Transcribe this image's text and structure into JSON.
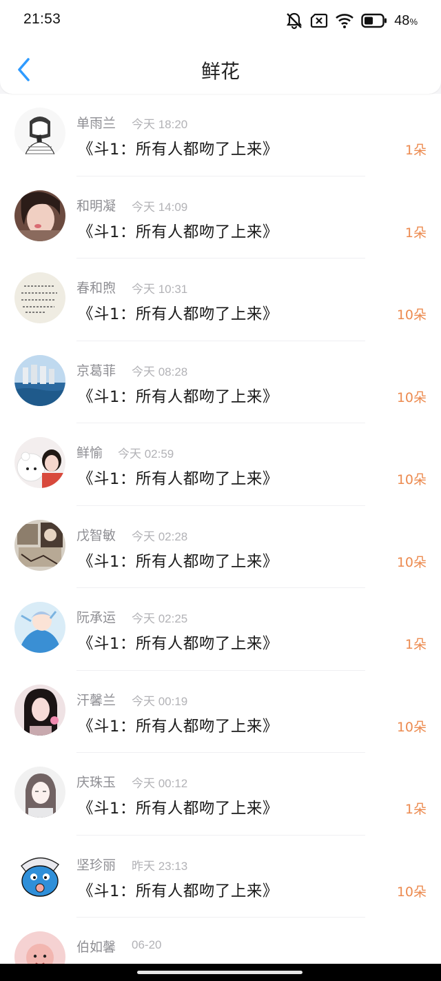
{
  "status_bar": {
    "time": "21:53",
    "battery_percent": "48",
    "battery_unit": "%",
    "battery_level": 0.48,
    "icons": [
      "mute-bell-icon",
      "sim-off-icon",
      "wifi-icon",
      "battery-icon"
    ]
  },
  "header": {
    "title": "鲜花",
    "back_icon": "chevron-left-icon",
    "accent_color": "#2f9bff"
  },
  "colors": {
    "amount": "#ec8a4f",
    "name": "#8e8e93",
    "timestamp": "#b2b2b6"
  },
  "items": [
    {
      "name": "单雨兰",
      "time": "今天 18:20",
      "book": "《斗1：所有人都吻了上来》",
      "amount": "1朵",
      "avatar": "sketch-girl-braid"
    },
    {
      "name": "和明凝",
      "time": "今天 14:09",
      "book": "《斗1：所有人都吻了上来》",
      "amount": "1朵",
      "avatar": "girl-selfie"
    },
    {
      "name": "春和煦",
      "time": "今天 10:31",
      "book": "《斗1：所有人都吻了上来》",
      "amount": "10朵",
      "avatar": "handwriting-paper"
    },
    {
      "name": "京葛菲",
      "time": "今天 08:28",
      "book": "《斗1：所有人都吻了上来》",
      "amount": "10朵",
      "avatar": "seaside-towers"
    },
    {
      "name": "鲜愉",
      "time": "今天 02:59",
      "book": "《斗1：所有人都吻了上来》",
      "amount": "10朵",
      "avatar": "bear-and-girl"
    },
    {
      "name": "戊智敏",
      "time": "今天 02:28",
      "book": "《斗1：所有人都吻了上来》",
      "amount": "10朵",
      "avatar": "manga-panel"
    },
    {
      "name": "阮承运",
      "time": "今天 02:25",
      "book": "《斗1：所有人都吻了上来》",
      "amount": "1朵",
      "avatar": "anime-boy-blue"
    },
    {
      "name": "汗馨兰",
      "time": "今天 00:19",
      "book": "《斗1：所有人都吻了上来》",
      "amount": "10朵",
      "avatar": "dark-hair-girl"
    },
    {
      "name": "庆珠玉",
      "time": "今天 00:12",
      "book": "《斗1：所有人都吻了上来》",
      "amount": "1朵",
      "avatar": "pale-girl"
    },
    {
      "name": "坚珍丽",
      "time": "昨天 23:13",
      "book": "《斗1：所有人都吻了上来》",
      "amount": "10朵",
      "avatar": "blue-cartoon-baby"
    },
    {
      "name": "伯如馨",
      "time": "06-20",
      "book": "",
      "amount": "",
      "avatar": "pink-baby"
    }
  ]
}
